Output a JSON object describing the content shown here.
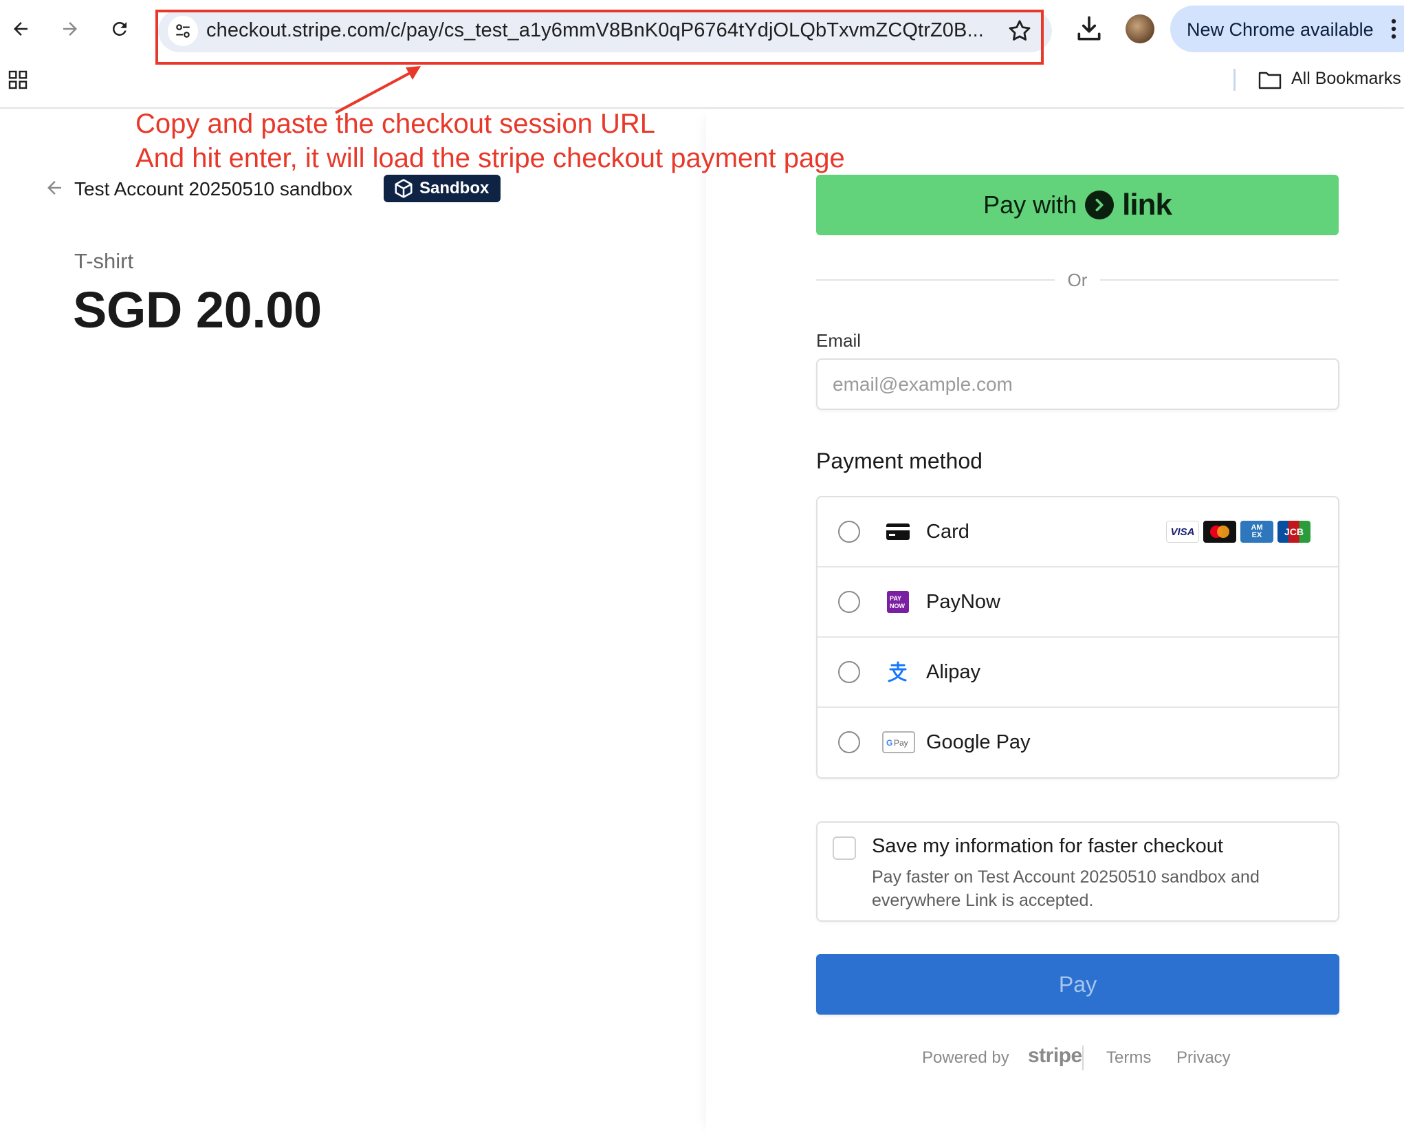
{
  "browser": {
    "url": "checkout.stripe.com/c/pay/cs_test_a1y6mmV8BnK0qP6764tYdjOLQbTxvmZCQtrZ0B...",
    "chrome_update_label": "New Chrome available",
    "bookmarks_label": "All Bookmarks",
    "icons": [
      "back-icon",
      "forward-icon",
      "reload-icon",
      "site-settings-icon",
      "star-icon",
      "download-icon",
      "profile-avatar",
      "more-icon",
      "apps-icon",
      "folder-icon"
    ]
  },
  "annotation": {
    "line1": "Copy and paste the checkout session URL",
    "line2": "And hit enter, it will load the stripe checkout payment page",
    "color": "#e8382a"
  },
  "merchant": {
    "name": "Test Account 20250510 sandbox",
    "badge": "Sandbox"
  },
  "order": {
    "product": "T-shirt",
    "price": "SGD 20.00"
  },
  "checkout": {
    "link_button_prefix": "Pay with",
    "link_button_brand": "link",
    "or_label": "Or",
    "email_label": "Email",
    "email_placeholder": "email@example.com",
    "email_value": "",
    "payment_method_title": "Payment method",
    "methods": [
      {
        "label": "Card",
        "icon": "card-icon",
        "brands": [
          "VISA",
          "Mastercard",
          "AMEX",
          "JCB"
        ]
      },
      {
        "label": "PayNow",
        "icon": "paynow-icon"
      },
      {
        "label": "Alipay",
        "icon": "alipay-icon"
      },
      {
        "label": "Google Pay",
        "icon": "google-pay-icon"
      }
    ],
    "save_title": "Save my information for faster checkout",
    "save_desc": "Pay faster on Test Account 20250510 sandbox and everywhere Link is accepted.",
    "pay_label": "Pay",
    "colors": {
      "link_green": "#62d37a",
      "pay_blue": "#2d71d0",
      "badge_navy": "#0f2345"
    }
  },
  "footer": {
    "powered_by": "Powered by",
    "brand": "stripe",
    "terms": "Terms",
    "privacy": "Privacy"
  }
}
